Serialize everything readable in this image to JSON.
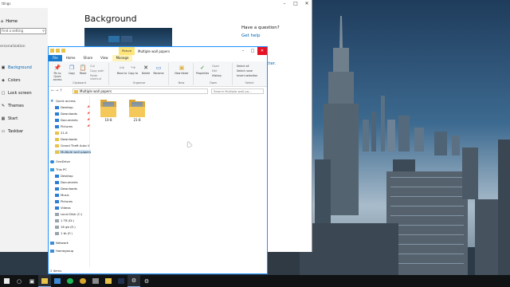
{
  "settings": {
    "window_title": "ttings",
    "home_label": "Home",
    "search_placeholder": "Find a setting",
    "section_label": "ersonalization",
    "nav": [
      {
        "label": "Background",
        "icon": "image-icon",
        "active": true
      },
      {
        "label": "Colors",
        "icon": "palette-icon",
        "active": false
      },
      {
        "label": "Lock screen",
        "icon": "monitor-lock-icon",
        "active": false
      },
      {
        "label": "Themes",
        "icon": "brush-icon",
        "active": false
      },
      {
        "label": "Start",
        "icon": "start-grid-icon",
        "active": false
      },
      {
        "label": "Taskbar",
        "icon": "taskbar-icon",
        "active": false
      }
    ],
    "heading": "Background",
    "question": "Have a question?",
    "help_link": "Get help",
    "partial_link": "tter."
  },
  "explorer": {
    "picture_tools_tab": "Picture Tools",
    "window_title": "Multiple wall papers",
    "tabs": [
      "File",
      "Home",
      "Share",
      "View",
      "Manage"
    ],
    "ribbon": {
      "clipboard": {
        "label": "Clipboard",
        "pin_label": "Pin to Quick access",
        "copy_label": "Copy",
        "paste_label": "Paste",
        "cut_label": "Cut",
        "copy_path_label": "Copy path",
        "paste_shortcut_label": "Paste shortcut"
      },
      "organize": {
        "label": "Organize",
        "move_label": "Move to",
        "copy_to_label": "Copy to",
        "delete_label": "Delete",
        "rename_label": "Rename"
      },
      "new": {
        "label": "New",
        "new_folder_label": "New folder"
      },
      "open": {
        "label": "Open",
        "properties_label": "Properties",
        "open_label": "Open",
        "edit_label": "Edit",
        "history_label": "History"
      },
      "select": {
        "label": "Select",
        "select_all": "Select all",
        "select_none": "Select none",
        "invert_selection": "Invert selection"
      }
    },
    "address_path": "Multiple wall papers",
    "search_placeholder": "Search Multiple wall pa...",
    "nav_tree": [
      {
        "label": "Quick access",
        "icon": "star-icon",
        "pinned": false
      },
      {
        "label": "Desktop",
        "icon": "desktop-icon",
        "pinned": true
      },
      {
        "label": "Downloads",
        "icon": "downloads-icon",
        "pinned": true
      },
      {
        "label": "Documents",
        "icon": "documents-icon",
        "pinned": true
      },
      {
        "label": "Pictures",
        "icon": "pictures-icon",
        "pinned": true
      },
      {
        "label": "21-8",
        "icon": "folder-icon",
        "pinned": false
      },
      {
        "label": "Downloads",
        "icon": "folder-icon",
        "pinned": false
      },
      {
        "label": "Grand Theft Auto V",
        "icon": "folder-icon",
        "pinned": false
      },
      {
        "label": "Multiple wall papers",
        "icon": "folder-icon",
        "pinned": false
      },
      {
        "label": "OneDrive",
        "icon": "cloud-icon",
        "pinned": false
      },
      {
        "label": "This PC",
        "icon": "pc-icon",
        "pinned": false
      },
      {
        "label": "Desktop",
        "icon": "desktop-icon",
        "pinned": false
      },
      {
        "label": "Documents",
        "icon": "documents-icon",
        "pinned": false
      },
      {
        "label": "Downloads",
        "icon": "downloads-icon",
        "pinned": false
      },
      {
        "label": "Music",
        "icon": "music-icon",
        "pinned": false
      },
      {
        "label": "Pictures",
        "icon": "pictures-icon",
        "pinned": false
      },
      {
        "label": "Videos",
        "icon": "videos-icon",
        "pinned": false
      },
      {
        "label": "Local Disk (C:)",
        "icon": "drive-icon",
        "pinned": false
      },
      {
        "label": "1 TB (D:)",
        "icon": "drive-icon",
        "pinned": false
      },
      {
        "label": "16 gb (E:)",
        "icon": "drive-icon",
        "pinned": false
      },
      {
        "label": "1 tb (F:)",
        "icon": "drive-icon",
        "pinned": false
      },
      {
        "label": "Network",
        "icon": "network-icon",
        "pinned": false
      },
      {
        "label": "Homegroup",
        "icon": "homegroup-icon",
        "pinned": false
      }
    ],
    "folders": [
      {
        "label": "10-8"
      },
      {
        "label": "21-8"
      }
    ],
    "status_text": "2 items"
  },
  "taskbar": {
    "items": [
      {
        "icon": "windows-start-icon"
      },
      {
        "icon": "cortana-icon"
      },
      {
        "icon": "task-view-icon"
      },
      {
        "icon": "file-explorer-icon"
      },
      {
        "icon": "store-icon"
      },
      {
        "icon": "media-icon"
      },
      {
        "icon": "chrome-icon"
      },
      {
        "icon": "app-icon"
      },
      {
        "icon": "folder-icon"
      },
      {
        "icon": "photoshop-icon"
      },
      {
        "icon": "settings-icon"
      },
      {
        "icon": "gear-icon"
      }
    ]
  },
  "colors": {
    "accent": "#0063b1",
    "ribbon_file_tab": "#1979ca",
    "taskbar": "#101214"
  }
}
